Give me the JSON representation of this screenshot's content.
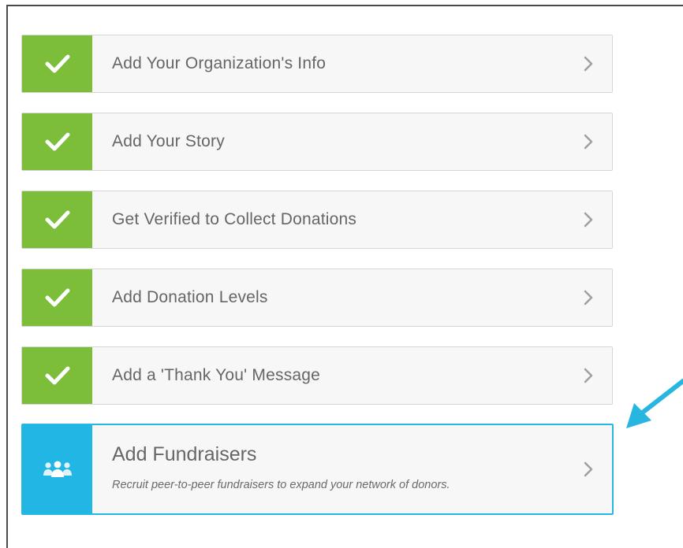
{
  "steps": [
    {
      "label": "Add Your Organization's Info",
      "status": "complete",
      "icon": "check-icon"
    },
    {
      "label": "Add Your Story",
      "status": "complete",
      "icon": "check-icon"
    },
    {
      "label": "Get Verified to Collect Donations",
      "status": "complete",
      "icon": "check-icon"
    },
    {
      "label": "Add Donation Levels",
      "status": "complete",
      "icon": "check-icon"
    },
    {
      "label": "Add a 'Thank You' Message",
      "status": "complete",
      "icon": "check-icon"
    }
  ],
  "active_step": {
    "title": "Add Fundraisers",
    "description": "Recruit peer-to-peer fundraisers to expand your network of donors.",
    "icon": "people-group-icon",
    "status": "incomplete"
  },
  "colors": {
    "complete_badge": "#7cbd3a",
    "active_badge": "#22b6e4",
    "active_border": "#27b6e0",
    "pointer_arrow": "#27b6e0",
    "row_bg": "#f7f7f7",
    "text": "#666666"
  },
  "annotation": {
    "icon": "pointer-arrow-icon"
  }
}
